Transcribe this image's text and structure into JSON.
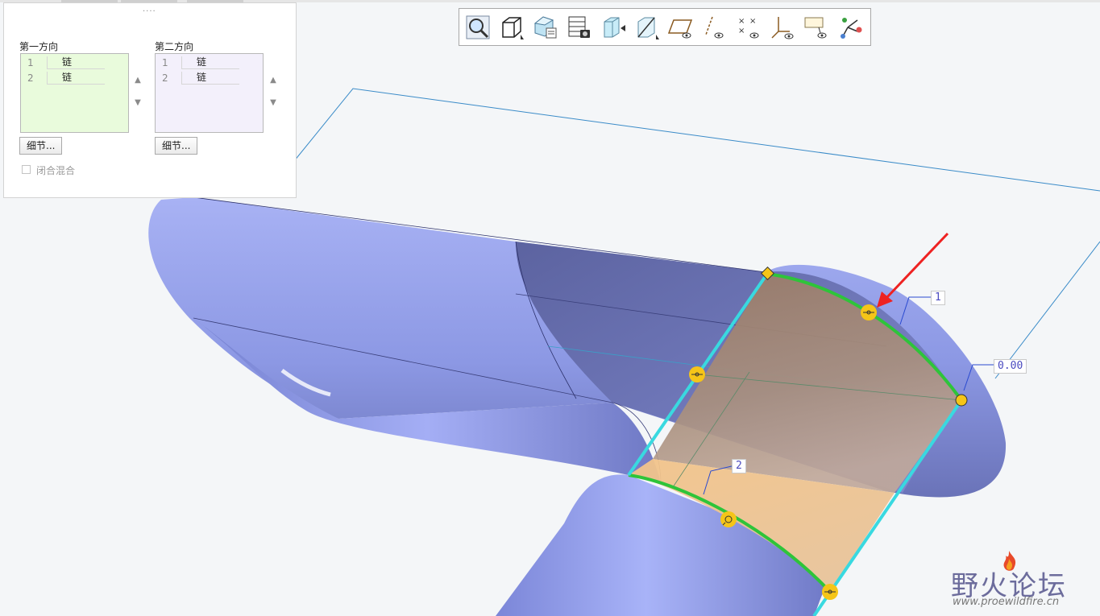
{
  "panel": {
    "grip": "....",
    "first_direction": {
      "label": "第一方向",
      "rows": [
        {
          "num": "1",
          "value": "链"
        },
        {
          "num": "2",
          "value": "链"
        }
      ],
      "details_button": "细节..."
    },
    "second_direction": {
      "label": "第二方向",
      "rows": [
        {
          "num": "1",
          "value": "链"
        },
        {
          "num": "2",
          "value": "链"
        }
      ],
      "details_button": "细节..."
    },
    "closed_blend": {
      "label": "闭合混合",
      "checked": false
    }
  },
  "toolbar": {
    "buttons": [
      "zoom-in-icon",
      "display-style-icon",
      "saved-orientation-icon",
      "view-manager-icon",
      "repaint-icon",
      "plane-display-icon",
      "datum-plane-display-icon",
      "axis-display-icon",
      "point-display-icon",
      "csys-display-icon",
      "annotation-display-icon",
      "spin-center-icon"
    ]
  },
  "viewport": {
    "labels": {
      "curve_1": "1",
      "curve_2": "2",
      "value_tag": "0.00"
    }
  },
  "watermark": {
    "title": "野火论坛",
    "url": "www.proewildfire.cn"
  },
  "colors": {
    "surface": "#8f9ce6",
    "boundary_green": "#2ec43a",
    "boundary_cyan": "#39d9e0",
    "handle_yellow": "#f5c518",
    "arrow_red": "#ee2222"
  }
}
